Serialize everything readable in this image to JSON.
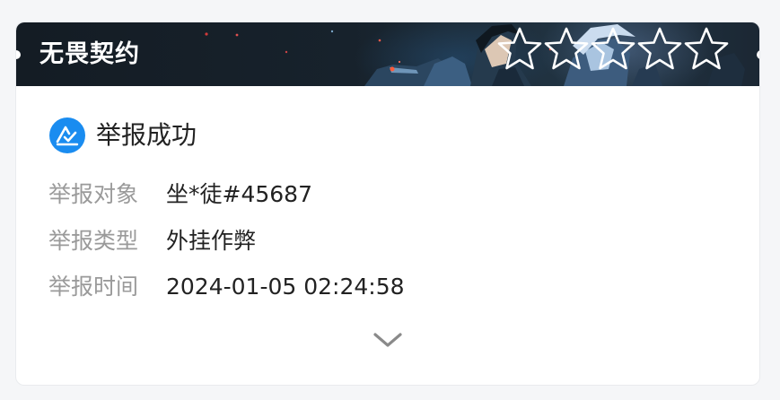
{
  "card": {
    "banner": {
      "title": "无畏契约",
      "star_count": 5,
      "icons": [
        "star-outline-icon"
      ]
    },
    "result": {
      "icon": "report-success-icon",
      "text": "举报成功",
      "accent_color": "#1a8cf0"
    },
    "details": [
      {
        "label": "举报对象",
        "value": "坐*徒#45687"
      },
      {
        "label": "举报类型",
        "value": "外挂作弊"
      },
      {
        "label": "举报时间",
        "value": "2024-01-05 02:24:58"
      }
    ],
    "expand_icon": "chevron-down-icon"
  }
}
